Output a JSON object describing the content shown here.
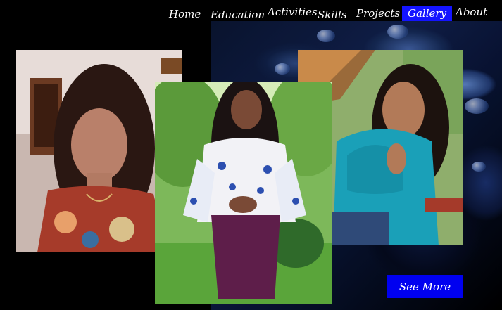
{
  "nav": {
    "items": [
      {
        "id": "home",
        "label": "Home"
      },
      {
        "id": "education",
        "label": "Education"
      },
      {
        "id": "activities",
        "label": "Activities"
      },
      {
        "id": "skills",
        "label": "Skills"
      },
      {
        "id": "projects",
        "label": "Projects"
      },
      {
        "id": "gallery",
        "label": "Gallery"
      },
      {
        "id": "about",
        "label": "About"
      }
    ],
    "active": "gallery"
  },
  "gallery": {
    "see_more_label": "See More"
  },
  "colors": {
    "background": "#000000",
    "accent": "#1414ff",
    "button": "#0000f0",
    "text": "#ffffff"
  }
}
